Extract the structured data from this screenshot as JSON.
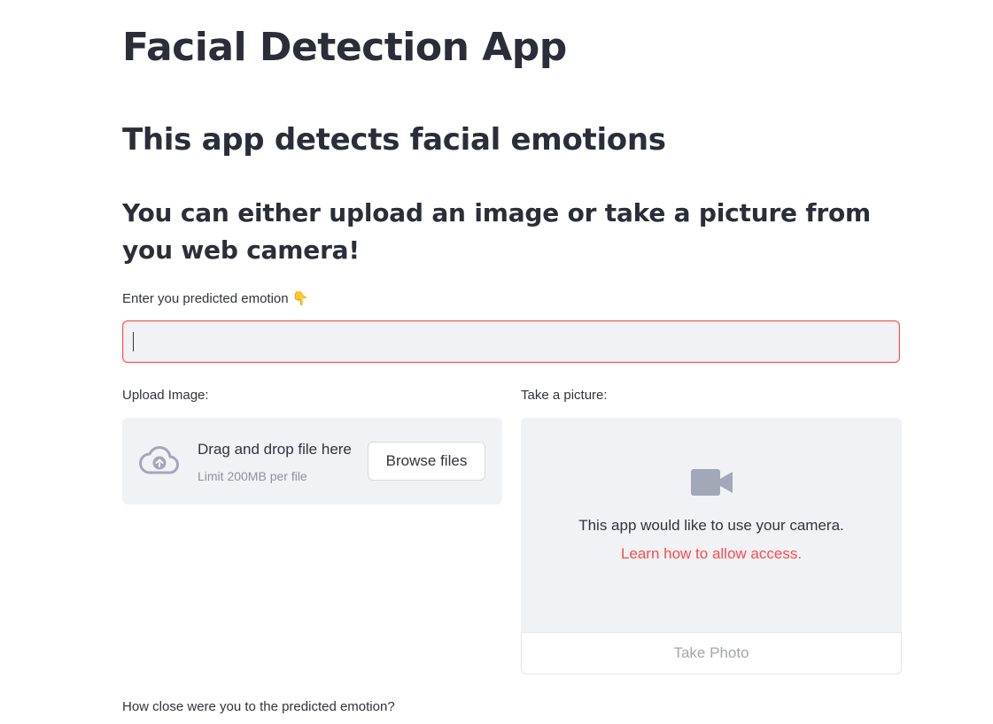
{
  "page": {
    "title": "Facial Detection App",
    "subtitle": "This app detects facial emotions",
    "instruction": "You can either upload an image or take a picture from you web camera!"
  },
  "emotion_input": {
    "label": "Enter you predicted emotion",
    "label_icon": "pointing-down-hand-emoji",
    "value": ""
  },
  "uploader": {
    "label": "Upload Image:",
    "drop_text": "Drag and drop file here",
    "limit_text": "Limit 200MB per file",
    "button_label": "Browse files",
    "icon": "cloud-upload-icon"
  },
  "camera": {
    "label": "Take a picture:",
    "icon": "video-camera-icon",
    "message": "This app would like to use your camera.",
    "link_text": "Learn how to allow access.",
    "button_label": "Take Photo"
  },
  "closeness": {
    "label": "How close were you to the predicted emotion?"
  },
  "colors": {
    "accent": "#ff4b4b",
    "panel_bg": "#f0f2f6",
    "text": "#31333f",
    "muted": "#8e919b",
    "icon": "#a3a8b8"
  }
}
